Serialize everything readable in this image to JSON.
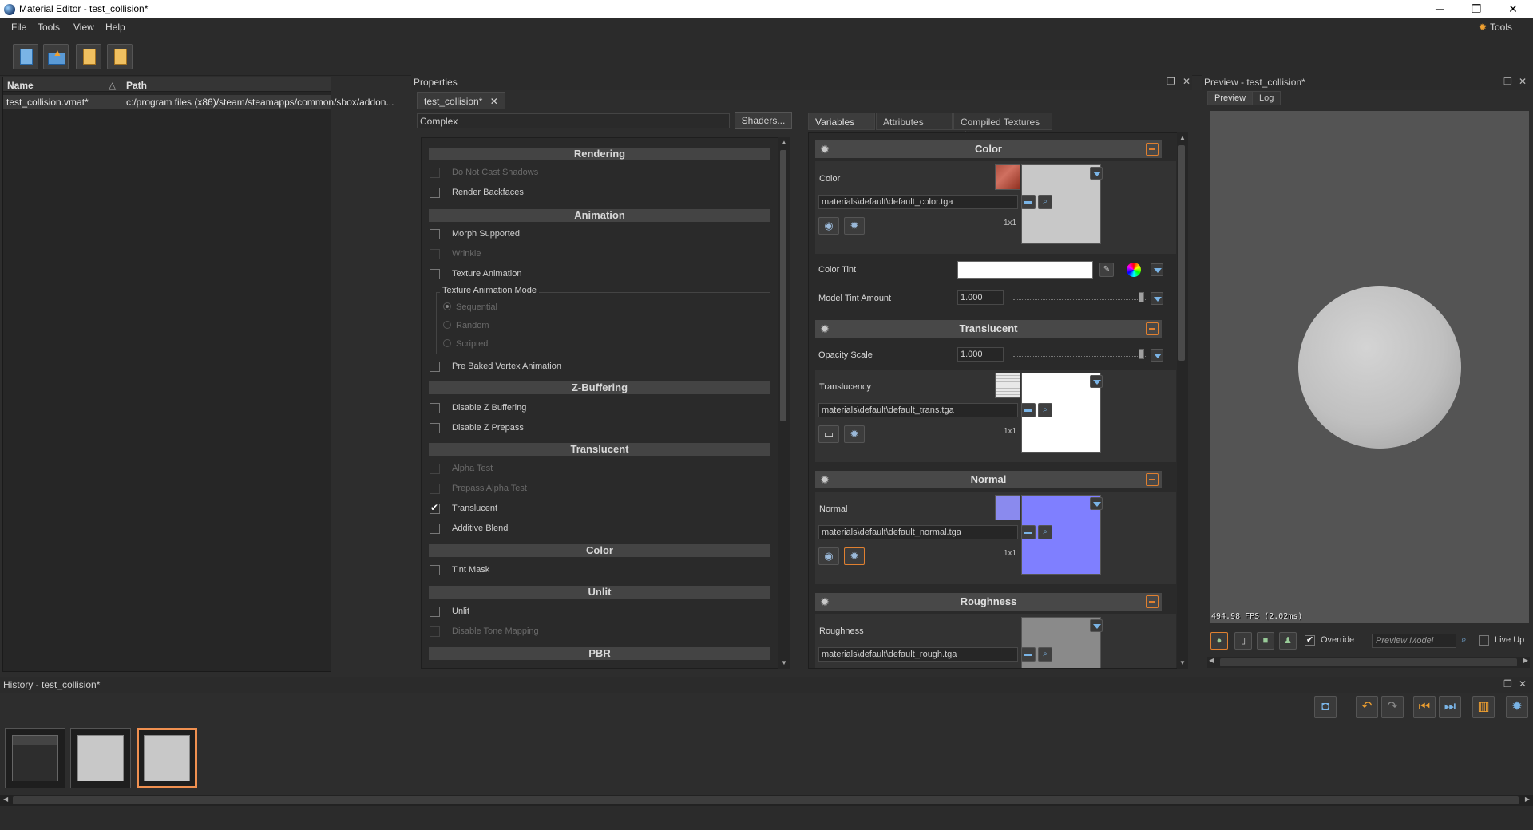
{
  "window": {
    "title": "Material Editor - test_collision*",
    "min": "─",
    "max": "❐",
    "close": "✕"
  },
  "menu": {
    "items": [
      "File",
      "Tools",
      "View",
      "Help"
    ],
    "right_tools": "Tools"
  },
  "filelist": {
    "col_name": "Name",
    "col_path": "Path",
    "sort_indicator": "△",
    "rows": [
      {
        "name": "test_collision.vmat*",
        "path": "c:/program files (x86)/steam/steamapps/common/sbox/addon..."
      }
    ]
  },
  "properties": {
    "title": "Properties",
    "tab": "test_collision*",
    "tab_close": "✕",
    "shader_field": "Complex",
    "shaders_button": "Shaders...",
    "sections": {
      "rendering": "Rendering",
      "animation": "Animation",
      "zbuffering": "Z-Buffering",
      "translucent": "Translucent",
      "color": "Color",
      "unlit": "Unlit",
      "pbr": "PBR"
    },
    "items": {
      "do_not_cast_shadows": "Do Not Cast Shadows",
      "render_backfaces": "Render Backfaces",
      "morph_supported": "Morph Supported",
      "wrinkle": "Wrinkle",
      "texture_animation": "Texture Animation",
      "texture_animation_mode": "Texture Animation Mode",
      "sequential": "Sequential",
      "random": "Random",
      "scripted": "Scripted",
      "pre_baked_vertex_animation": "Pre Baked Vertex Animation",
      "disable_z_buffering": "Disable Z Buffering",
      "disable_z_prepass": "Disable Z Prepass",
      "alpha_test": "Alpha Test",
      "prepass_alpha_test": "Prepass Alpha Test",
      "translucent": "Translucent",
      "additive_blend": "Additive Blend",
      "tint_mask": "Tint Mask",
      "unlit": "Unlit",
      "disable_tone_mapping": "Disable Tone Mapping"
    }
  },
  "variables": {
    "tabs": [
      "Variables",
      "Attributes",
      "Compiled Textures"
    ],
    "tab_close": "✕",
    "color": {
      "header": "Color",
      "label": "Color",
      "path": "materials\\default\\default_color.tga",
      "size": "1x1",
      "tint_label": "Color Tint",
      "tint_value": "#ffffff",
      "model_tint_label": "Model Tint Amount",
      "model_tint_value": "1.000"
    },
    "translucent": {
      "header": "Translucent",
      "opacity_label": "Opacity Scale",
      "opacity_value": "1.000",
      "label": "Translucency",
      "path": "materials\\default\\default_trans.tga",
      "size": "1x1"
    },
    "normal": {
      "header": "Normal",
      "label": "Normal",
      "path": "materials\\default\\default_normal.tga",
      "size": "1x1"
    },
    "roughness": {
      "header": "Roughness",
      "label": "Roughness",
      "path": "materials\\default\\default_rough.tga"
    }
  },
  "preview": {
    "title": "Preview - test_collision*",
    "tabs": [
      "Preview",
      "Log"
    ],
    "fps": "494.98 FPS (2.02ms)",
    "override_label": "Override",
    "model_placeholder": "Preview Model",
    "live_label": "Live Up"
  },
  "history": {
    "title": "History - test_collision*"
  },
  "colors": {
    "accent": "#f09050",
    "normal_map": "#7f7fff",
    "panel_bg": "#2d2d2d"
  }
}
